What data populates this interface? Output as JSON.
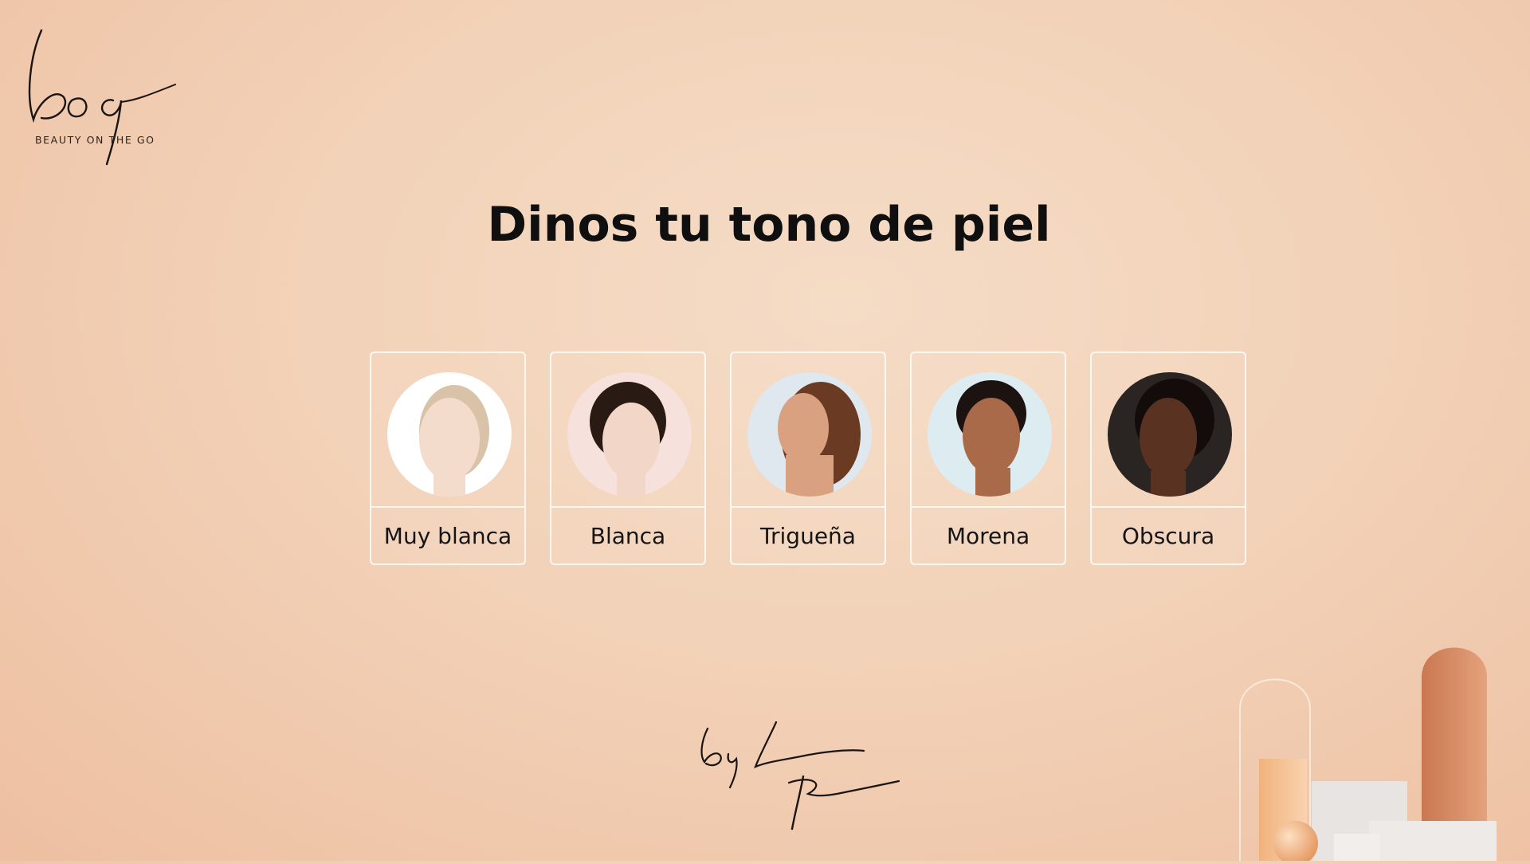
{
  "logo": {
    "mark": "bog",
    "tagline": "BEAUTY  ON THE GO"
  },
  "header": {
    "title": "Dinos tu tono de piel"
  },
  "skin_tones": [
    {
      "label": "Muy blanca",
      "skin": "#f4dccd",
      "hair": "#d8c3a8",
      "bg": "#ffffff"
    },
    {
      "label": "Blanca",
      "skin": "#f2d6c8",
      "hair": "#2a1a14",
      "bg": "#f6e1dc"
    },
    {
      "label": "Trigueña",
      "skin": "#d9a17f",
      "hair": "#6b3a22",
      "bg": "#dfe8ef"
    },
    {
      "label": "Morena",
      "skin": "#a86a48",
      "hair": "#1c1210",
      "bg": "#dcecf1"
    },
    {
      "label": "Obscura",
      "skin": "#5a3222",
      "hair": "#140c0a",
      "bg": "#2a2422"
    }
  ],
  "signature": {
    "line1": "by Laura",
    "line2": "Rivera"
  },
  "colors": {
    "background": "#f2d2b8",
    "card_border": "#fff8f2",
    "title": "#0f0f0f"
  }
}
